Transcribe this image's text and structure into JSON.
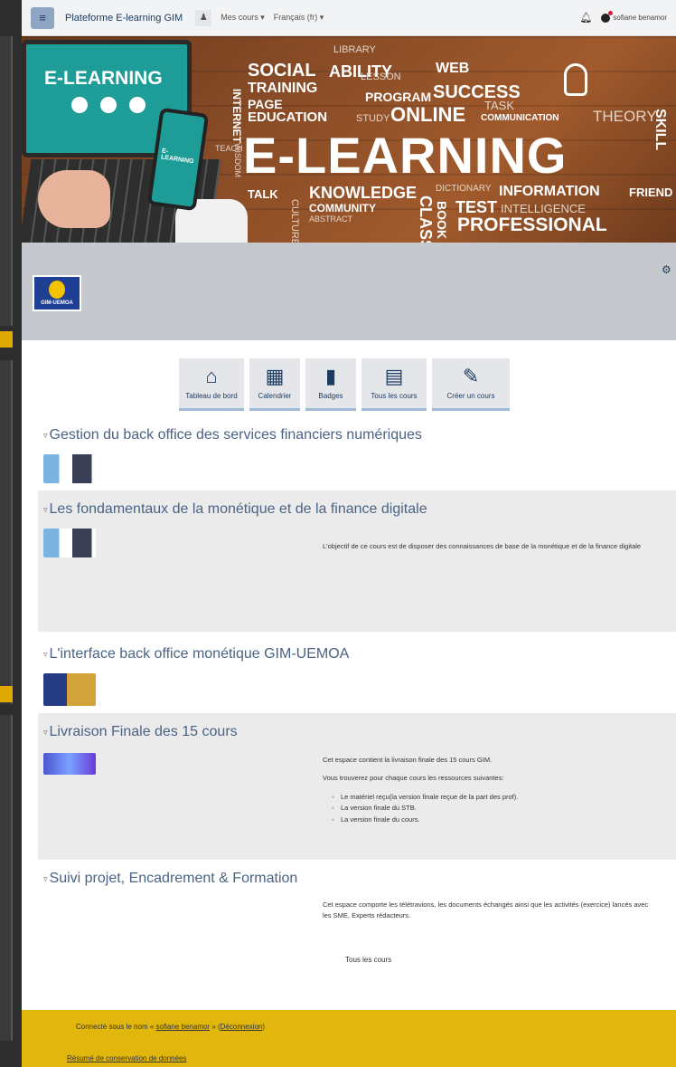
{
  "navbar": {
    "brand": "Plateforme E-learning GIM",
    "my_courses": "Mes cours ▾",
    "language": "Français (fr) ▾",
    "user_name": "sofiane benamor"
  },
  "banner": {
    "laptop_title": "E-LEARNING",
    "phone_text": "E-LEARNING",
    "words": [
      "SOCIAL",
      "TRAINING",
      "PAGE",
      "EDUCATION",
      "ABILITY",
      "LIBRARY",
      "LESSON",
      "WEB",
      "PROGRAM",
      "SUCCESS",
      "TASK",
      "STUDY",
      "ONLINE",
      "COMMUNICATION",
      "THEORY",
      "E-LEARNING",
      "SKILL",
      "TALK",
      "KNOWLEDGE",
      "DICTIONARY",
      "INFORMATION",
      "FRIEND",
      "COMMUNITY",
      "TEST",
      "INTELLIGENCE",
      "ABSTRACT",
      "PROFESSIONAL",
      "INTERNET",
      "WISDOM",
      "TEACH",
      "BOOK",
      "CULTURE",
      "CLASS"
    ]
  },
  "header": {
    "logo_text": "GIM-UEMOA"
  },
  "quicklinks": [
    {
      "label": "Tableau de bord",
      "icon": "home-icon"
    },
    {
      "label": "Calendrier",
      "icon": "calendar-icon"
    },
    {
      "label": "Badges",
      "icon": "bookmark-icon"
    },
    {
      "label": "Tous les cours",
      "icon": "book-icon"
    },
    {
      "label": "Créer un cours",
      "icon": "edit-icon"
    }
  ],
  "courses": [
    {
      "title": "Gestion du back office des services financiers numériques"
    },
    {
      "title": "Les fondamentaux de la monétique et de la finance digitale",
      "summary": "L'objectif de ce cours est de disposer des connaissances de base de la monétique et de la finance digitale"
    },
    {
      "title": "L'interface back office monétique GIM-UEMOA"
    },
    {
      "title": "Livraison Finale des 15 cours",
      "summary_p1": "Cet espace contient la livraison finale des 15 cours GIM.",
      "summary_p2": "Vous trouverez pour chaque cours les ressources suivantes:",
      "items": [
        "Le matériel reçu(la version finale reçue de la part des prof).",
        "La version finale du STB.",
        "La version finale du cours."
      ]
    },
    {
      "title": "Suivi projet, Encadrement & Formation",
      "summary": "Cet espace comporte les télétravions, les documents échangés ainsi que les activités (exercice) lancés avec les SME, Experts rédacteurs."
    }
  ],
  "all_courses_link": "Tous les cours",
  "footer": {
    "logged_in_prefix": "Connecté sous le nom « ",
    "user_link": "sofiane benamor",
    "logout_prefix": " » (",
    "logout_link": "Déconnexion",
    "logout_suffix": ")",
    "data_retention": "Résumé de conservation de données"
  },
  "colors": {
    "accent": "#1d3c61",
    "footer": "#e1b60d",
    "header_card": "#c5c8cc"
  }
}
